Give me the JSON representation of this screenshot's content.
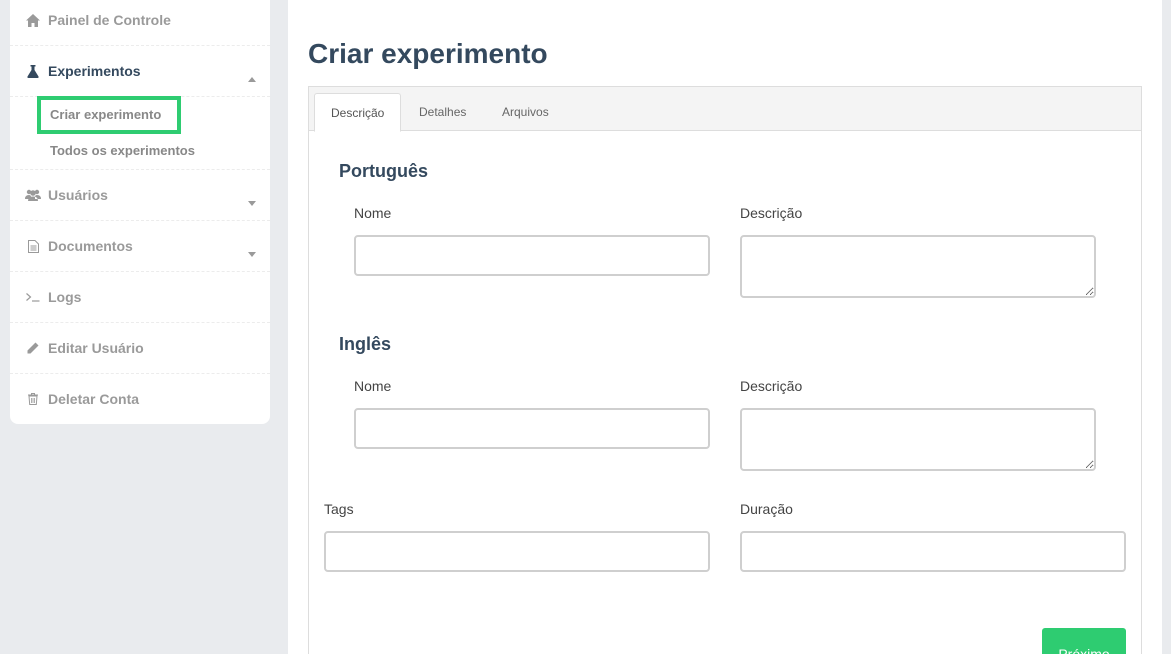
{
  "sidebar": {
    "items": [
      {
        "label": "Painel de Controle",
        "icon": "home-icon"
      },
      {
        "label": "Experimentos",
        "icon": "flask-icon"
      },
      {
        "label": "Usuários",
        "icon": "users-icon"
      },
      {
        "label": "Documentos",
        "icon": "document-icon"
      },
      {
        "label": "Logs",
        "icon": "terminal-icon"
      },
      {
        "label": "Editar Usuário",
        "icon": "pencil-icon"
      },
      {
        "label": "Deletar Conta",
        "icon": "trash-icon"
      }
    ],
    "experiment_submenu": [
      {
        "label": "Criar experimento"
      },
      {
        "label": "Todos os experimentos"
      }
    ]
  },
  "main": {
    "title": "Criar experimento",
    "tabs": [
      {
        "label": "Descrição"
      },
      {
        "label": "Detalhes"
      },
      {
        "label": "Arquivos"
      }
    ],
    "form": {
      "portuguese": {
        "title": "Português",
        "name_label": "Nome",
        "name_value": "",
        "description_label": "Descrição",
        "description_value": ""
      },
      "english": {
        "title": "Inglês",
        "name_label": "Nome",
        "name_value": "",
        "description_label": "Descrição",
        "description_value": ""
      },
      "tags_label": "Tags",
      "tags_value": "",
      "duration_label": "Duração",
      "duration_value": ""
    },
    "next_label": "Próximo"
  },
  "colors": {
    "accent": "#2ecc71",
    "heading": "#34495e",
    "muted": "#9a9a9a",
    "background": "#e9ebee"
  }
}
